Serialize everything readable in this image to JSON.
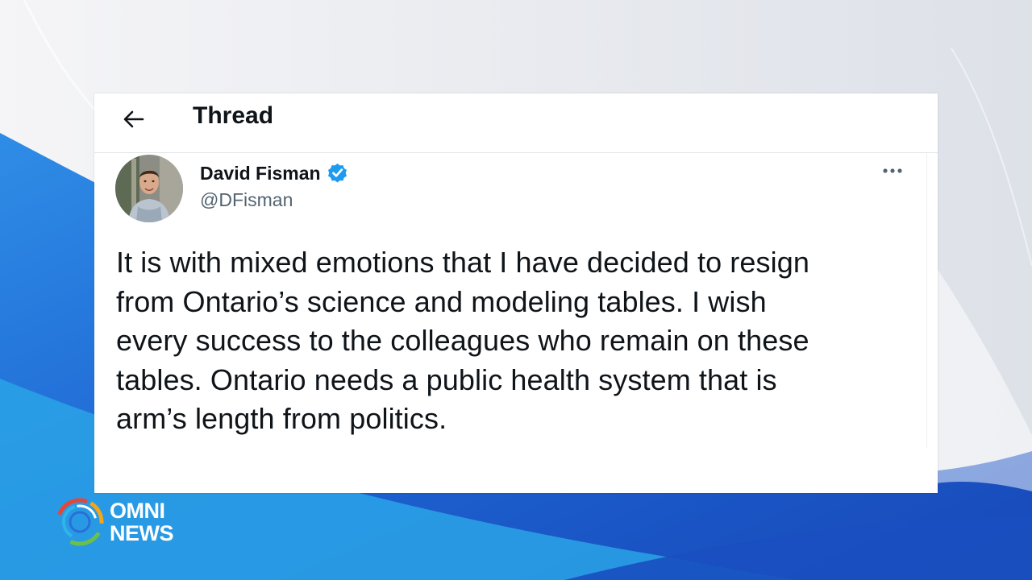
{
  "header": {
    "back_icon": "arrow-left-icon",
    "title": "Thread"
  },
  "tweet": {
    "author_name": "David Fisman",
    "author_handle": "@DFisman",
    "verified": true,
    "verified_icon": "verified-badge-icon",
    "more_icon": "more-options-icon",
    "text": "It is with mixed emotions that I have decided to resign\nfrom Ontario’s science and modeling tables.  I wish\nevery success to the colleagues who remain on these\ntables. Ontario needs a public health system that is\narm’s length from politics."
  },
  "branding": {
    "logo_line1": "OMNI",
    "logo_line2": "NEWS"
  },
  "colors": {
    "verified_blue": "#1d9bf0",
    "text_primary": "#0f1419",
    "text_secondary": "#536471",
    "background_blue": "#1e6fd8"
  }
}
